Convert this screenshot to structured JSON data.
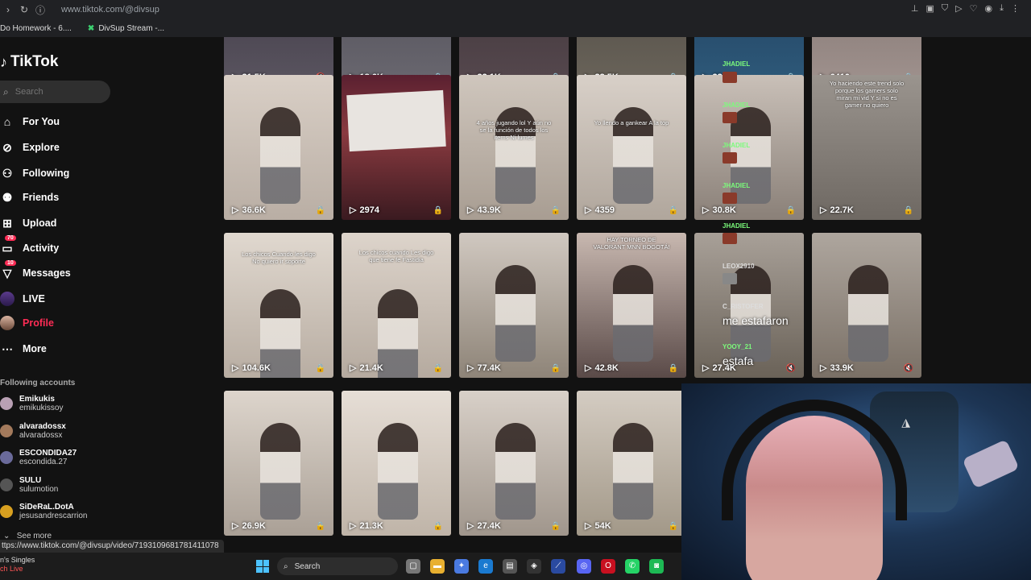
{
  "browser": {
    "url": "www.tiktok.com/@divsup",
    "bookmarks": [
      "Do Homework - 6....",
      "DivSup Stream -..."
    ]
  },
  "sidebar": {
    "logo": "TikTok",
    "search_placeholder": "Search",
    "nav": [
      {
        "label": "For You",
        "icon": "home-icon"
      },
      {
        "label": "Explore",
        "icon": "compass-icon"
      },
      {
        "label": "Following",
        "icon": "user-icon"
      },
      {
        "label": "Friends",
        "icon": "friends-icon"
      },
      {
        "label": "Upload",
        "icon": "plus-square-icon"
      },
      {
        "label": "Activity",
        "icon": "inbox-icon",
        "badge": "70"
      },
      {
        "label": "Messages",
        "icon": "send-icon",
        "badge": "10"
      },
      {
        "label": "LIVE",
        "icon": "live-icon"
      },
      {
        "label": "Profile",
        "icon": "avatar-icon"
      },
      {
        "label": "More",
        "icon": "more-icon"
      }
    ],
    "following_title": "Following accounts",
    "accounts": [
      {
        "name": "Emikukis",
        "handle": "emikukissoy"
      },
      {
        "name": "alvaradossx",
        "handle": "alvaradossx"
      },
      {
        "name": "ESCONDIDA27",
        "handle": "escondida.27"
      },
      {
        "name": "SULU",
        "handle": "sulumotion"
      },
      {
        "name": "SiDeRaL.DotA",
        "handle": "jesusandrescarrion"
      }
    ],
    "see_more": "See more"
  },
  "grid": {
    "rows": [
      [
        "21.5K",
        "18.6K",
        "22.1K",
        "23.5K",
        "22.5K",
        "6410"
      ],
      [
        "36.6K",
        "2974",
        "43.9K",
        "4359",
        "30.8K",
        "22.7K"
      ],
      [
        "104.6K",
        "21.4K",
        "77.4K",
        "42.8K",
        "27.4K",
        "33.9K"
      ],
      [
        "26.9K",
        "21.3K",
        "27.4K",
        "54K"
      ]
    ],
    "captions": {
      "r1c3": "4 años jugando lol Y aún no se la función de todos los items Ni lumes",
      "r1c4": "Yo llendo a gankear A la top",
      "r1c6": "Yo haciendo este trend solo porque los gamers solo miran mi vid Y si no es gamer no quiero",
      "r2c1": "Los chicos Cuando les digo No quiero ir soporte",
      "r2c2": "Los chicos cuando Les digo que tiene fe Fastidia",
      "r2c4": "HAY TORNEO DE VALORANT MNN BOGOTÁ!"
    }
  },
  "chat": [
    {
      "user": "JHADIEL"
    },
    {
      "user": "JHADIEL"
    },
    {
      "user": "JHADIEL"
    },
    {
      "user": "JHADIEL"
    },
    {
      "user": "JHADIEL"
    },
    {
      "user": "LEOX2910"
    },
    {
      "user": "C_RISTOFER",
      "msg": "me estafaron"
    },
    {
      "user": "YOOY_21",
      "msg": "estafa"
    }
  ],
  "status_url": "ttps://www.tiktok.com/@divsup/video/7193109681781411078",
  "taskbar": {
    "media_title": "n's Singles",
    "media_sub": "ch Live",
    "search_label": "Search"
  },
  "colors": {
    "accent": "#fe2c55",
    "chat_user": "#7cfc7c"
  }
}
